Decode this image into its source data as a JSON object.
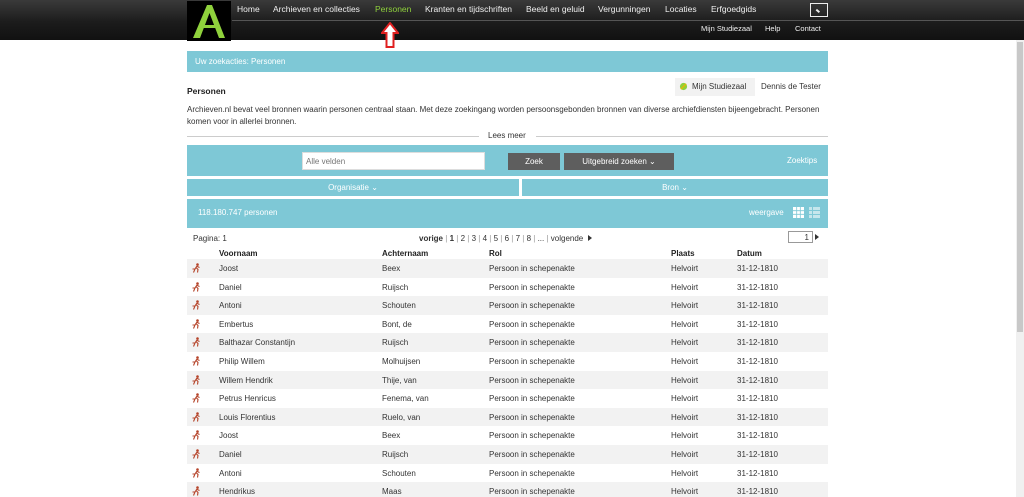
{
  "nav": {
    "items": [
      {
        "label": "Home",
        "active": false
      },
      {
        "label": "Archieven en collecties",
        "active": false
      },
      {
        "label": "Personen",
        "active": true
      },
      {
        "label": "Kranten en tijdschriften",
        "active": false
      },
      {
        "label": "Beeld en geluid",
        "active": false
      },
      {
        "label": "Vergunningen",
        "active": false
      },
      {
        "label": "Locaties",
        "active": false
      },
      {
        "label": "Erfgoedgids",
        "active": false
      }
    ],
    "sub_items": [
      "Mijn Studiezaal",
      "Help",
      "Contact"
    ],
    "logo_letter": "A",
    "active_color": "#8fd13c"
  },
  "breadcrumb": "Uw zoekacties: Personen",
  "account": {
    "studiezaal_label": "Mijn Studiezaal",
    "user_name": "Dennis de Tester"
  },
  "page": {
    "title": "Personen",
    "intro": "Archieven.nl bevat veel bronnen waarin personen centraal staan. Met deze zoekingang worden persoonsgebonden bronnen van diverse archiefdiensten bijeengebracht. Personen komen voor in allerlei bronnen.",
    "read_more": "Lees meer"
  },
  "search": {
    "placeholder": "Alle velden",
    "search_button": "Zoek",
    "advanced_button": "Uitgebreid zoeken",
    "tips": "Zoektips"
  },
  "filters": {
    "organisatie": "Organisatie",
    "bron": "Bron"
  },
  "results": {
    "count": "118.180.747 personen",
    "view_label": "weergave",
    "page_label": "Pagina: 1",
    "prev": "vorige",
    "pages": [
      "1",
      "2",
      "3",
      "4",
      "5",
      "6",
      "7",
      "8",
      "..."
    ],
    "current_page": "1",
    "next": "volgende",
    "page_input": "1"
  },
  "table": {
    "headers": [
      "Voornaam",
      "Achternaam",
      "Rol",
      "Plaats",
      "Datum"
    ],
    "rows": [
      [
        "Joost",
        "Beex",
        "Persoon in schepenakte",
        "Helvoirt",
        "31-12-1810"
      ],
      [
        "Daniel",
        "Ruijsch",
        "Persoon in schepenakte",
        "Helvoirt",
        "31-12-1810"
      ],
      [
        "Antoni",
        "Schouten",
        "Persoon in schepenakte",
        "Helvoirt",
        "31-12-1810"
      ],
      [
        "Embertus",
        "Bont, de",
        "Persoon in schepenakte",
        "Helvoirt",
        "31-12-1810"
      ],
      [
        "Balthazar Constantijn",
        "Ruijsch",
        "Persoon in schepenakte",
        "Helvoirt",
        "31-12-1810"
      ],
      [
        "Philip Willem",
        "Molhuijsen",
        "Persoon in schepenakte",
        "Helvoirt",
        "31-12-1810"
      ],
      [
        "Willem Hendrik",
        "Thije, van",
        "Persoon in schepenakte",
        "Helvoirt",
        "31-12-1810"
      ],
      [
        "Petrus Henricus",
        "Fenema, van",
        "Persoon in schepenakte",
        "Helvoirt",
        "31-12-1810"
      ],
      [
        "Louis Florentius",
        "Ruelo, van",
        "Persoon in schepenakte",
        "Helvoirt",
        "31-12-1810"
      ],
      [
        "Joost",
        "Beex",
        "Persoon in schepenakte",
        "Helvoirt",
        "31-12-1810"
      ],
      [
        "Daniel",
        "Ruijsch",
        "Persoon in schepenakte",
        "Helvoirt",
        "31-12-1810"
      ],
      [
        "Antoni",
        "Schouten",
        "Persoon in schepenakte",
        "Helvoirt",
        "31-12-1810"
      ],
      [
        "Hendrikus",
        "Maas",
        "Persoon in schepenakte",
        "Helvoirt",
        "31-12-1810"
      ]
    ],
    "row_icon": "person-running-icon"
  },
  "colors": {
    "accent": "#7ec8d6",
    "topbar": "#1c1c1c",
    "arrow": "#e02020"
  }
}
